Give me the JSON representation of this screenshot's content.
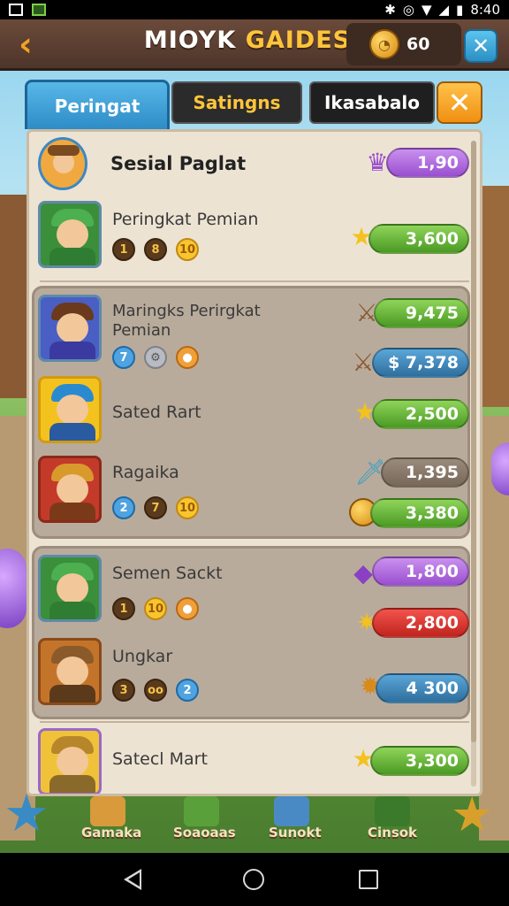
{
  "status_bar": {
    "time": "8:40"
  },
  "header": {
    "title_white": "MIOYK",
    "title_gold": "GAIDES",
    "coins": "60"
  },
  "tabs": [
    {
      "label": "Peringat"
    },
    {
      "label": "Satingns"
    },
    {
      "label": "Ikasabalo"
    }
  ],
  "rows": [
    {
      "name": "Sesial Paglat",
      "value": "1,90",
      "pill": "purple",
      "icon": "wizard-icon"
    },
    {
      "name": "Peringkat Pemian",
      "chips": [
        "1",
        "8",
        "10"
      ],
      "value": "3,600",
      "pill": "green",
      "icon": "star-icon"
    },
    {
      "name": "Maringks Perirgkat Pemian",
      "chips": [
        "7",
        "",
        ""
      ],
      "value": "9,475",
      "pill": "green",
      "icon": "warrior-icon"
    },
    {
      "name": "",
      "value": "$ 7,378",
      "pill": "blue",
      "icon": "warrior-icon"
    },
    {
      "name": "Sated Rart",
      "value": "2,500",
      "pill": "green",
      "icon": "star-icon"
    },
    {
      "name": "Ragaika",
      "chips": [
        "2",
        "7",
        "10"
      ],
      "value": "1,395",
      "pill": "brown",
      "icon": "sword-icon"
    },
    {
      "name": "",
      "value": "3,380",
      "pill": "green",
      "icon": "coin-icon"
    },
    {
      "name": "Semen Sackt",
      "chips": [
        "1",
        "10",
        ""
      ],
      "value": "1,800",
      "pill": "purple",
      "icon": "gem-icon"
    },
    {
      "name": "",
      "value": "2,800",
      "pill": "red",
      "icon": "badge-icon"
    },
    {
      "name": "Ungkar",
      "chips": [
        "3",
        "oo",
        "2"
      ],
      "value": "4 300",
      "pill": "blue",
      "icon": "sun-icon"
    },
    {
      "name": "Satecl Mart",
      "value": "3,300",
      "pill": "green",
      "icon": "star-icon"
    }
  ],
  "game_nav": [
    {
      "label": "Gamaka"
    },
    {
      "label": "Soaoaas"
    },
    {
      "label": "Sunokt"
    },
    {
      "label": "Cinsok"
    }
  ],
  "colors": {
    "accent_blue": "#2e8cc7",
    "gold": "#ffc53a",
    "panel": "#ede3d3"
  }
}
